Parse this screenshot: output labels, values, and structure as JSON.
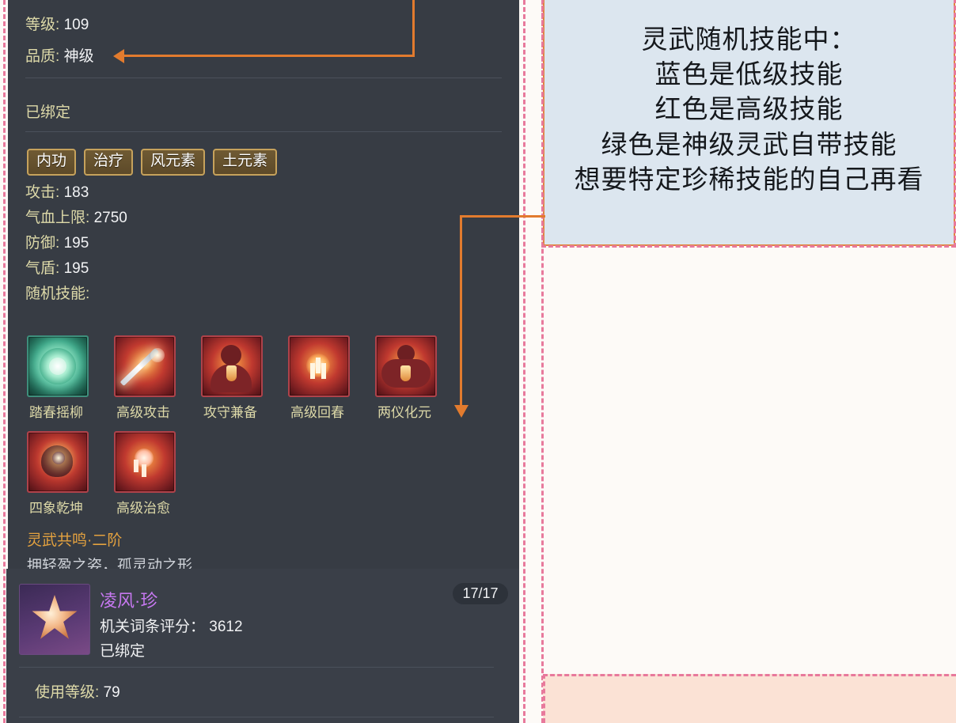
{
  "panel_top": {
    "level_label": "等级:",
    "level_value": "109",
    "quality_label": "品质:",
    "quality_value": "神级",
    "bound_text": "已绑定",
    "tags": [
      "内功",
      "治疗",
      "风元素",
      "土元素"
    ],
    "stats": [
      {
        "label": "攻击:",
        "value": "183"
      },
      {
        "label": "气血上限:",
        "value": "2750"
      },
      {
        "label": "防御:",
        "value": "195"
      },
      {
        "label": "气盾:",
        "value": "195"
      }
    ],
    "random_skills_label": "随机技能:",
    "skills_row1": [
      {
        "name": "踏春摇柳",
        "rarity_color": "green"
      },
      {
        "name": "高级攻击",
        "rarity_color": "red"
      },
      {
        "name": "攻守兼备",
        "rarity_color": "red"
      },
      {
        "name": "高级回春",
        "rarity_color": "red"
      },
      {
        "name": "两仪化元",
        "rarity_color": "red"
      }
    ],
    "skills_row2": [
      {
        "name": "四象乾坤",
        "rarity_color": "red"
      },
      {
        "name": "高级治愈",
        "rarity_color": "red"
      }
    ],
    "resonance_title": "灵武共鸣·二阶",
    "resonance_desc": "拥轻盈之姿，孤灵动之形"
  },
  "panel_bottom": {
    "item_name": "凌风·珍",
    "score_text": "机关词条评分： 3612",
    "bound_text": "已绑定",
    "count_badge": "17/17",
    "use_level_label": "使用等级:",
    "use_level_value": "79"
  },
  "annotation": {
    "lines": [
      "灵武随机技能中：",
      "蓝色是低级技能",
      "红色是高级技能",
      "绿色是神级灵武自带技能",
      "想要特定珍稀技能的自己再看"
    ]
  },
  "colors": {
    "panel_bg": "#373c44",
    "gold_text": "#ddd9a8",
    "orange_accent": "#e27b2e",
    "pink_dash": "#e8799c",
    "note_bg": "#dce6ef",
    "peach_bg": "#fbe2d5",
    "item_name_purple": "#c678f0",
    "resonance_orange": "#e4a23f"
  }
}
